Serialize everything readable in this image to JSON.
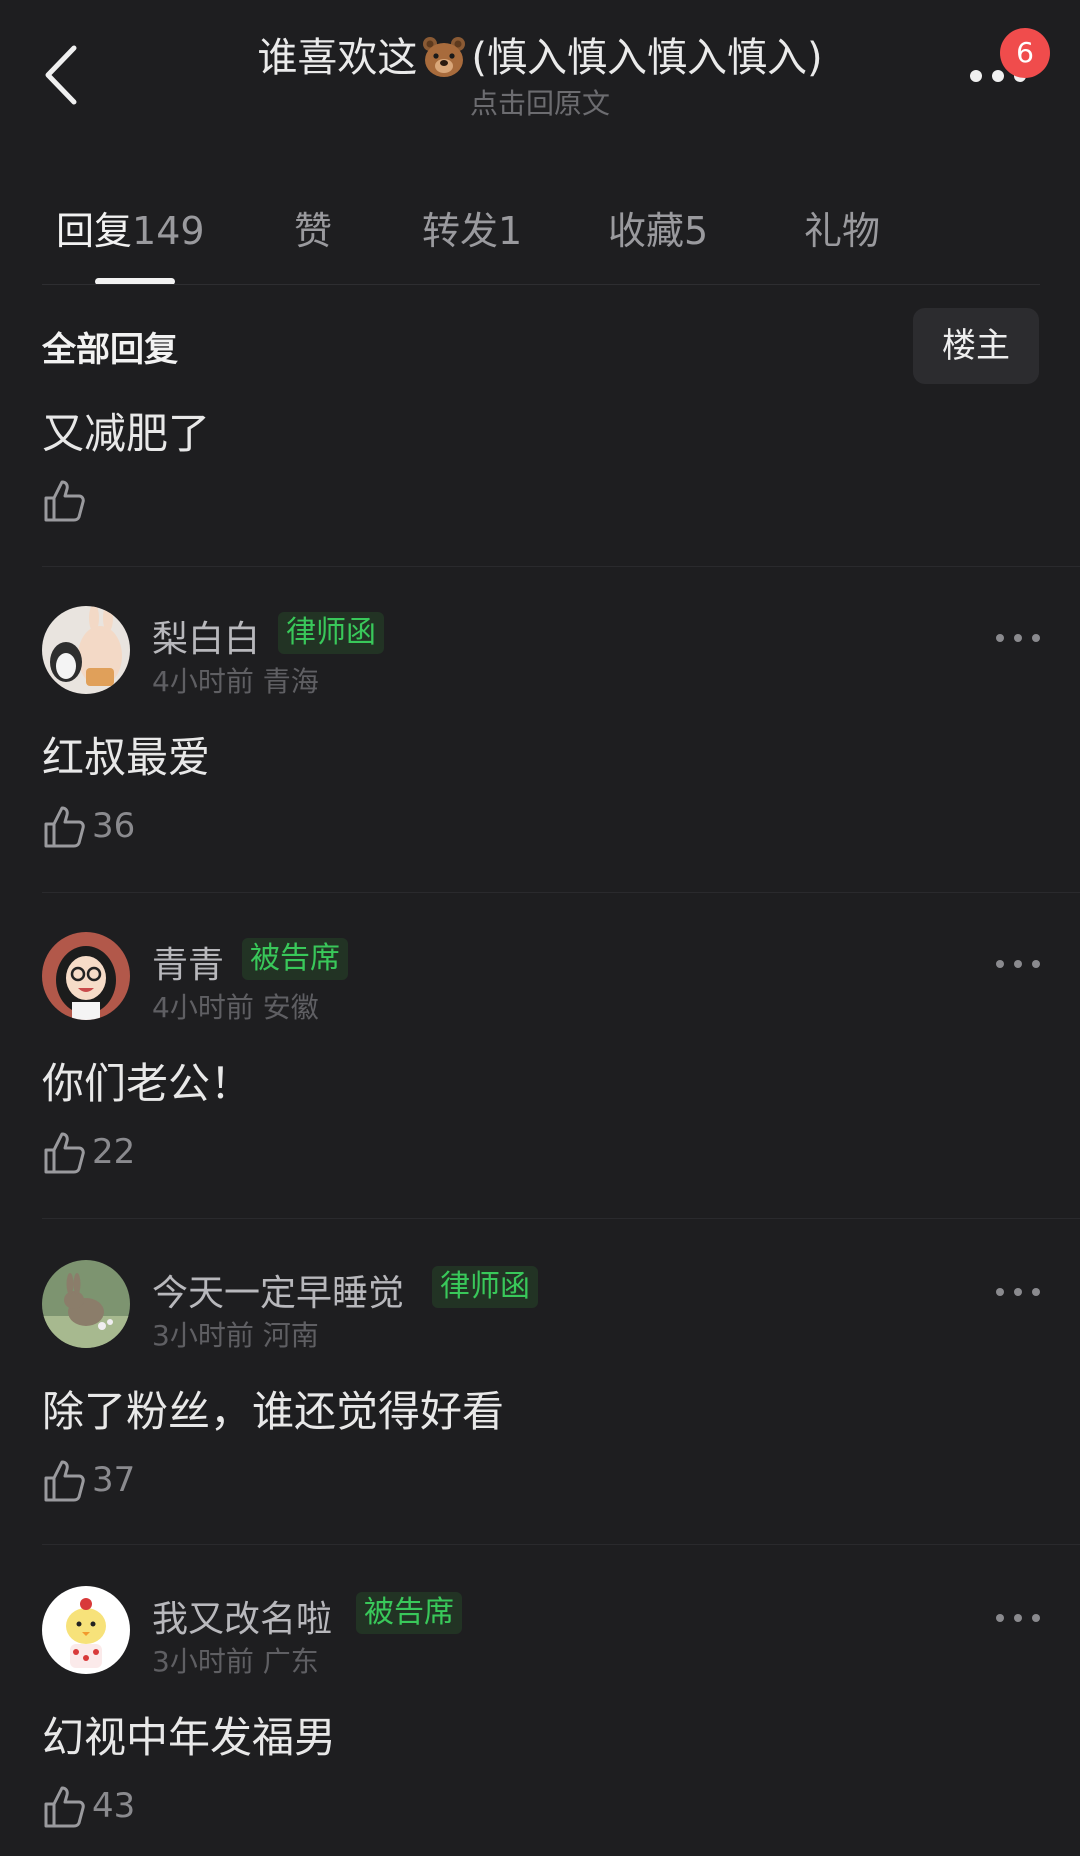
{
  "header": {
    "title_prefix": "谁喜欢这",
    "title_emoji": "bear-face-emoji",
    "title_suffix": "(慎入慎入慎入慎入)",
    "subtitle": "点击回原文",
    "notification_count": "6",
    "back_icon": "chevron-left-icon",
    "more_icon": "ellipsis-icon"
  },
  "tabs": [
    {
      "label": "回复",
      "count": "149",
      "active": true
    },
    {
      "label": "赞",
      "count": ""
    },
    {
      "label": "转发",
      "count": "1"
    },
    {
      "label": "收藏",
      "count": "5"
    },
    {
      "label": "礼物",
      "count": ""
    }
  ],
  "section": {
    "title": "全部回复",
    "filter_label": "楼主"
  },
  "comments": [
    {
      "username": "",
      "tag": "",
      "meta": "",
      "text": "又减肥了",
      "likes": ""
    },
    {
      "username": "梨白白",
      "tag": "律师函",
      "meta": "4小时前 青海",
      "text": "红叔最爱",
      "likes": "36"
    },
    {
      "username": "青青",
      "tag": "被告席",
      "meta": "4小时前 安徽",
      "text": "你们老公！",
      "likes": "22"
    },
    {
      "username": "今天一定早睡觉",
      "tag": "律师函",
      "meta": "3小时前 河南",
      "text": "除了粉丝，谁还觉得好看",
      "likes": "37"
    },
    {
      "username": "我又改名啦",
      "tag": "被告席",
      "meta": "3小时前 广东",
      "text": "幻视中年发福男",
      "likes": "43"
    }
  ],
  "colors": {
    "background": "#1e1e20",
    "badge": "#f04c4c",
    "tag_text": "#39c85a",
    "tag_bg": "#223324"
  }
}
